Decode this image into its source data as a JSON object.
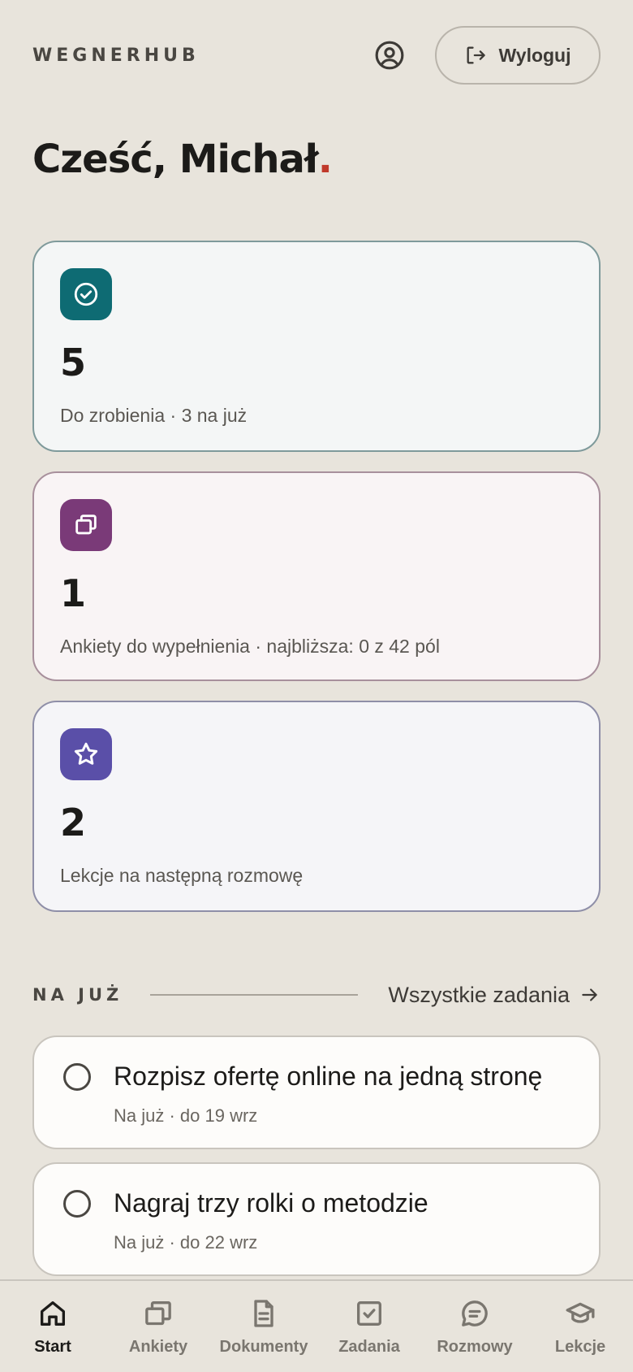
{
  "header": {
    "brand": "WEGNERHUB",
    "logout_label": "Wyloguj"
  },
  "greeting": {
    "text": "Cześć, Michał",
    "accent": "."
  },
  "cards": [
    {
      "icon": "check-circle-icon",
      "color": "#0e6b73",
      "value": "5",
      "subtitle": "Do zrobienia · 3 na już"
    },
    {
      "icon": "stacked-cards-icon",
      "color": "#7a3a78",
      "value": "1",
      "subtitle": "Ankiety do wypełnienia · najbliższa: 0 z 42 pól"
    },
    {
      "icon": "star-icon",
      "color": "#5a4fa8",
      "value": "2",
      "subtitle": "Lekcje na następną rozmowę"
    }
  ],
  "section": {
    "title": "NA JUŻ",
    "link_label": "Wszystkie zadania"
  },
  "tasks": [
    {
      "title": "Rozpisz ofertę online na jedną stronę",
      "meta": "Na już · do 19 wrz"
    },
    {
      "title": "Nagraj trzy rolki o metodzie",
      "meta": "Na już · do 22 wrz"
    }
  ],
  "nav": [
    {
      "label": "Start",
      "icon": "home-icon",
      "active": true
    },
    {
      "label": "Ankiety",
      "icon": "stacked-cards-icon",
      "active": false
    },
    {
      "label": "Dokumenty",
      "icon": "document-icon",
      "active": false
    },
    {
      "label": "Zadania",
      "icon": "checkbox-icon",
      "active": false
    },
    {
      "label": "Rozmowy",
      "icon": "chat-icon",
      "active": false
    },
    {
      "label": "Lekcje",
      "icon": "graduation-cap-icon",
      "active": false
    }
  ],
  "colors": {
    "background": "#e8e4dc",
    "accent_red": "#c0392b",
    "text_dark": "#1c1b19"
  }
}
